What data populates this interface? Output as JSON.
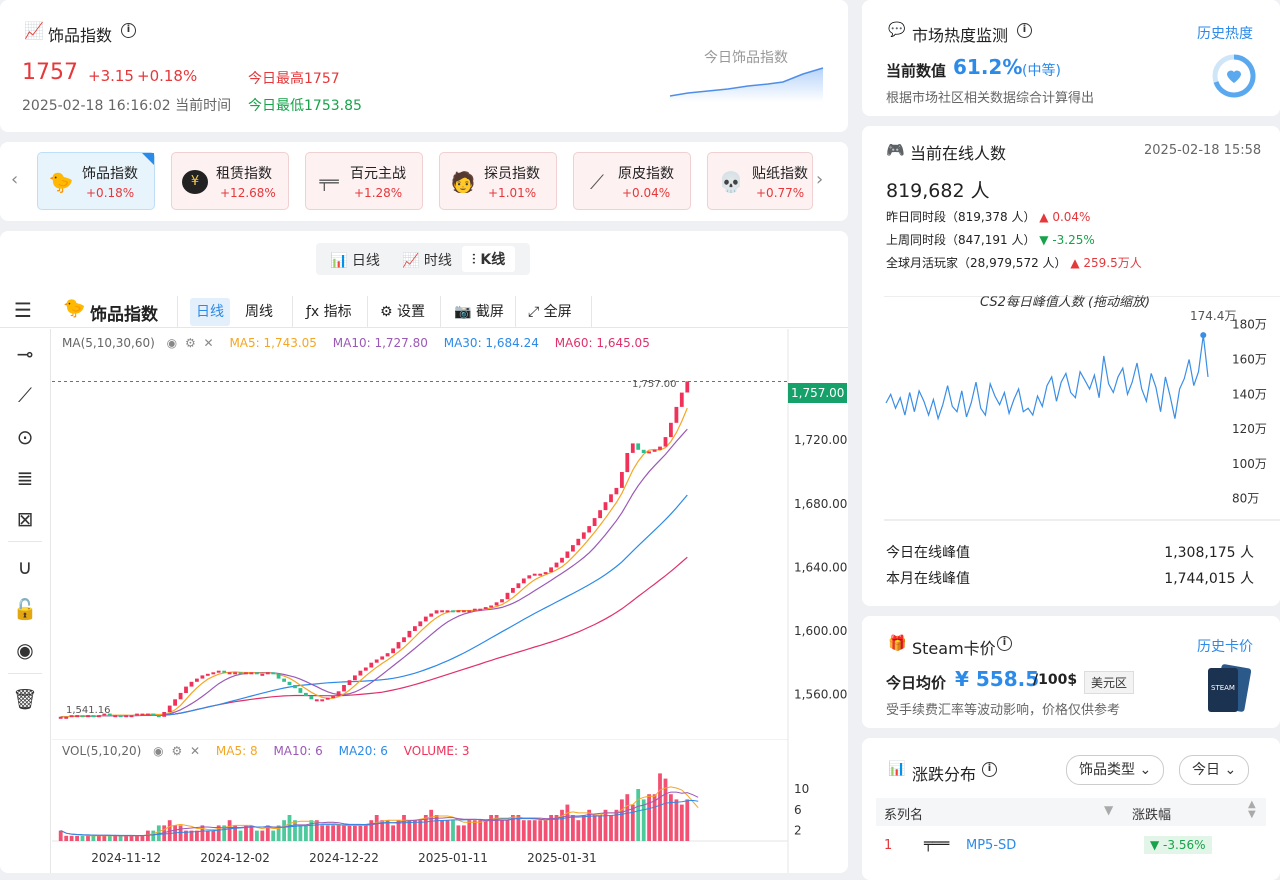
{
  "index": {
    "title": "饰品指数",
    "value": "1757",
    "change": "+3.15",
    "pct": "+0.18%",
    "high": "今日最高1757",
    "low": "今日最低1753.85",
    "time": "2025-02-18 16:16:02 当前时间",
    "spark_label": "今日饰品指数"
  },
  "heat": {
    "title": "市场热度监测",
    "history": "历史热度",
    "label": "当前数值",
    "value": "61.2%",
    "level": "(中等)",
    "desc": "根据市场社区相关数据综合计算得出"
  },
  "tiles": [
    {
      "name": "饰品指数",
      "change": "+0.18%",
      "icon": "duck-icon"
    },
    {
      "name": "租赁指数",
      "change": "+12.68%",
      "icon": "coin-icon"
    },
    {
      "name": "百元主战",
      "change": "+1.28%",
      "icon": "pistol-icon"
    },
    {
      "name": "探员指数",
      "change": "+1.01%",
      "icon": "agent-icon"
    },
    {
      "name": "原皮指数",
      "change": "+0.04%",
      "icon": "knife-icon"
    },
    {
      "name": "贴纸指数",
      "change": "+0.77%",
      "icon": "sticker-icon"
    }
  ],
  "online": {
    "title": "当前在线人数",
    "time": "2025-02-18 15:58",
    "count": "819,682 人",
    "rows": [
      {
        "label": "昨日同时段（819,378 人）",
        "change": "▲ 0.04%",
        "dir": "up"
      },
      {
        "label": "上周同时段（847,191 人）",
        "change": "▼ -3.25%",
        "dir": "down"
      },
      {
        "label": "全球月活玩家（28,979,572 人）",
        "change": "▲ 259.5万人",
        "dir": "up"
      }
    ],
    "chart_title": "CS2每日峰值人数 (拖动缩放)",
    "peak_label": "174.4万",
    "today_peak_label": "今日在线峰值",
    "today_peak": "1,308,175 人",
    "month_peak_label": "本月在线峰值",
    "month_peak": "1,744,015 人"
  },
  "steam": {
    "title": "Steam卡价",
    "history": "历史卡价",
    "label": "今日均价",
    "value": "¥ 558.5",
    "unit": "/100$",
    "region": "美元区",
    "desc": "受手续费汇率等波动影响，价格仅供参考"
  },
  "dist": {
    "title": "涨跌分布",
    "type_btn": "饰品类型",
    "day_btn": "今日",
    "col1": "系列名",
    "col2": "涨跌幅",
    "row_rank": "1",
    "row_name": "MP5-SD",
    "row_change": "▼ -3.56%"
  },
  "kline": {
    "tabs": [
      "日线",
      "时线",
      "K线"
    ],
    "title": "饰品指数",
    "periods": [
      "日线",
      "周线"
    ],
    "tools": [
      "指标",
      "设置",
      "截屏",
      "全屏"
    ],
    "ma_label": "MA(5,10,30,60)",
    "ma5": "MA5: 1,743.05",
    "ma10": "MA10: 1,727.80",
    "ma30": "MA30: 1,684.24",
    "ma60": "MA60: 1,645.05",
    "vol_label": "VOL(5,10,20)",
    "vma5": "MA5: 8",
    "vma10": "MA10: 6",
    "vma20": "MA20: 6",
    "volume": "VOLUME: 3",
    "last_price": "1,757.00",
    "high_mark": "1,757.00",
    "low_mark": "1,541.16",
    "colors": {
      "up": "#f0325a",
      "down": "#2fbf8b",
      "ma5": "#f5a623",
      "ma10": "#9b59b6",
      "ma30": "#2c8ae8",
      "ma60": "#e0306a"
    }
  },
  "chart_data": [
    {
      "type": "candlestick",
      "title": "饰品指数",
      "x_ticks": [
        "2024-11-12",
        "2024-12-02",
        "2024-12-22",
        "2025-01-11",
        "2025-01-31"
      ],
      "y_ticks": [
        1560,
        1600,
        1640,
        1680,
        1720
      ],
      "ylim": [
        1532,
        1790
      ],
      "close": [
        1546,
        1546,
        1547,
        1547,
        1546,
        1547,
        1546,
        1547,
        1548,
        1547,
        1547,
        1546,
        1547,
        1547,
        1548,
        1548,
        1548,
        1547,
        1546,
        1549,
        1553,
        1557,
        1561,
        1565,
        1568,
        1570,
        1572,
        1573,
        1574,
        1575,
        1574,
        1574,
        1574,
        1573,
        1574,
        1574,
        1573,
        1573,
        1574,
        1573,
        1570,
        1568,
        1566,
        1564,
        1561,
        1559,
        1557,
        1557,
        1557,
        1558,
        1559,
        1562,
        1566,
        1569,
        1572,
        1575,
        1577,
        1580,
        1582,
        1584,
        1586,
        1589,
        1593,
        1596,
        1600,
        1603,
        1606,
        1609,
        1611,
        1613,
        1613,
        1613,
        1612,
        1613,
        1613,
        1613,
        1614,
        1614,
        1615,
        1616,
        1618,
        1620,
        1624,
        1627,
        1630,
        1633,
        1635,
        1636,
        1636,
        1637,
        1640,
        1643,
        1646,
        1650,
        1654,
        1658,
        1662,
        1666,
        1671,
        1676,
        1681,
        1686,
        1690,
        1700,
        1712,
        1718,
        1714,
        1712,
        1713,
        1714,
        1716,
        1722,
        1731,
        1741,
        1750,
        1757
      ],
      "volume": [
        2,
        1,
        1,
        1,
        1,
        1,
        1,
        1,
        1,
        1,
        1,
        1,
        1,
        1,
        1,
        1,
        2,
        2,
        3,
        3,
        4,
        3,
        3,
        2,
        2,
        2,
        3,
        2,
        2,
        3,
        3,
        4,
        3,
        2,
        3,
        3,
        2,
        2,
        3,
        2,
        3,
        4,
        5,
        4,
        3,
        3,
        4,
        4,
        3,
        3,
        3,
        3,
        3,
        3,
        3,
        3,
        3,
        4,
        5,
        4,
        4,
        3,
        4,
        5,
        4,
        4,
        4,
        5,
        6,
        5,
        4,
        4,
        4,
        3,
        3,
        4,
        4,
        4,
        4,
        5,
        5,
        4,
        4,
        5,
        5,
        4,
        4,
        4,
        4,
        4,
        5,
        5,
        6,
        7,
        5,
        4,
        5,
        6,
        5,
        5,
        6,
        5,
        6,
        8,
        9,
        7,
        10,
        8,
        9,
        9,
        13,
        12,
        9,
        8,
        7,
        8,
        6,
        3
      ]
    },
    {
      "type": "line",
      "title": "CS2每日峰值人数 (拖动缩放)",
      "y_ticks": [
        "180万",
        "160万",
        "140万",
        "120万",
        "100万",
        "80万"
      ],
      "ylim": [
        70,
        185
      ],
      "values": [
        135,
        140,
        132,
        138,
        128,
        141,
        130,
        142,
        136,
        128,
        137,
        126,
        134,
        145,
        133,
        130,
        142,
        127,
        135,
        147,
        132,
        128,
        146,
        139,
        134,
        141,
        129,
        137,
        143,
        130,
        132,
        128,
        139,
        133,
        145,
        150,
        136,
        147,
        152,
        141,
        138,
        153,
        148,
        143,
        151,
        138,
        162,
        146,
        141,
        150,
        155,
        140,
        147,
        158,
        143,
        136,
        152,
        144,
        130,
        150,
        139,
        126,
        143,
        149,
        160,
        145,
        153,
        174,
        150
      ]
    }
  ]
}
